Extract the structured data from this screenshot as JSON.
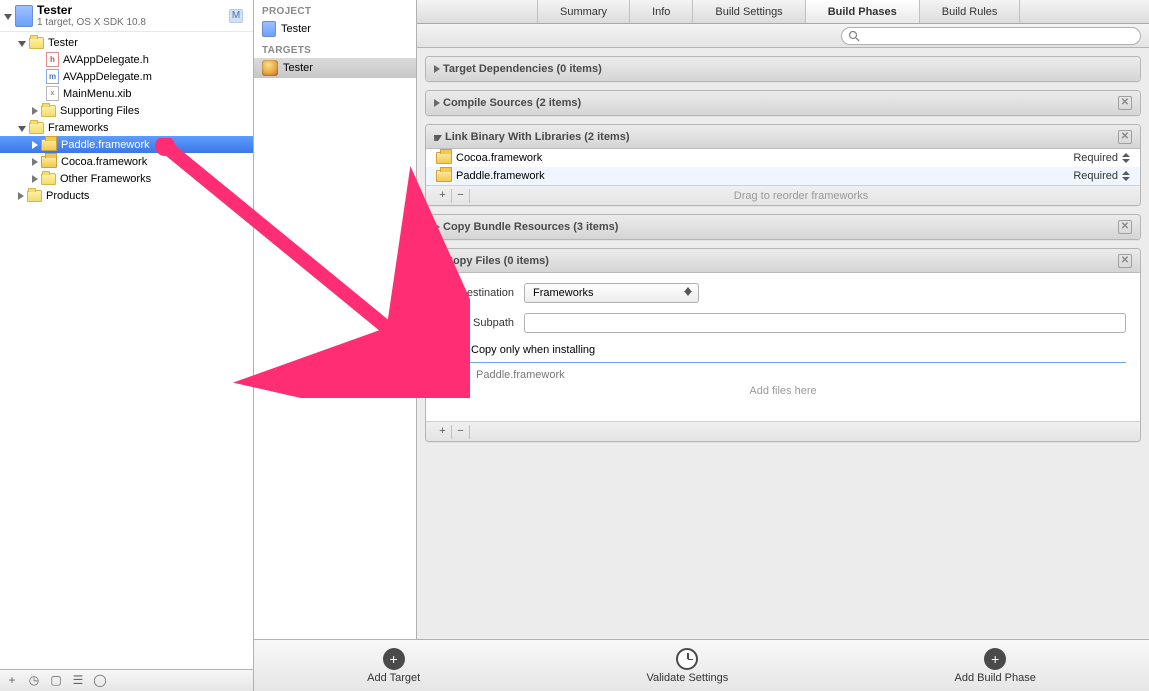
{
  "project": {
    "name": "Tester",
    "subtitle": "1 target, OS X SDK 10.8",
    "m_badge": "M"
  },
  "tree": {
    "root": "Tester",
    "items": [
      {
        "icon": "h",
        "label": "AVAppDelegate.h"
      },
      {
        "icon": "m",
        "label": "AVAppDelegate.m"
      },
      {
        "icon": "xib",
        "label": "MainMenu.xib"
      }
    ],
    "supporting": "Supporting Files",
    "frameworks_label": "Frameworks",
    "frameworks": [
      {
        "label": "Paddle.framework",
        "selected": true
      },
      {
        "label": "Cocoa.framework"
      },
      {
        "label": "Other Frameworks"
      }
    ],
    "products": "Products"
  },
  "targets_col": {
    "project_header": "PROJECT",
    "project_name": "Tester",
    "targets_header": "TARGETS",
    "target_name": "Tester"
  },
  "tabs": {
    "summary": "Summary",
    "info": "Info",
    "build_settings": "Build Settings",
    "build_phases": "Build Phases",
    "build_rules": "Build Rules"
  },
  "search": {
    "placeholder": ""
  },
  "phases": {
    "target_deps": "Target Dependencies (0 items)",
    "compile_sources": "Compile Sources (2 items)",
    "link_binary": {
      "title": "Link Binary With Libraries (2 items)",
      "rows": [
        {
          "name": "Cocoa.framework",
          "status": "Required"
        },
        {
          "name": "Paddle.framework",
          "status": "Required"
        }
      ],
      "footer_hint": "Drag to reorder frameworks"
    },
    "copy_bundle": "Copy Bundle Resources (3 items)",
    "copy_files": {
      "title": "Copy Files (0 items)",
      "dest_label": "Destination",
      "dest_value": "Frameworks",
      "subpath_label": "Subpath",
      "subpath_value": "",
      "checkbox_label": "Copy only when installing",
      "drag_item": "Paddle.framework",
      "drag_hint": "Add files here"
    }
  },
  "bottom": {
    "add_target": "Add Target",
    "validate": "Validate Settings",
    "add_phase": "Add Build Phase"
  },
  "glyphs": {
    "plus": "+",
    "minus": "−",
    "x": "✕",
    "filter": "☰",
    "clock": "◷",
    "box": "▢",
    "circle": "◯"
  }
}
